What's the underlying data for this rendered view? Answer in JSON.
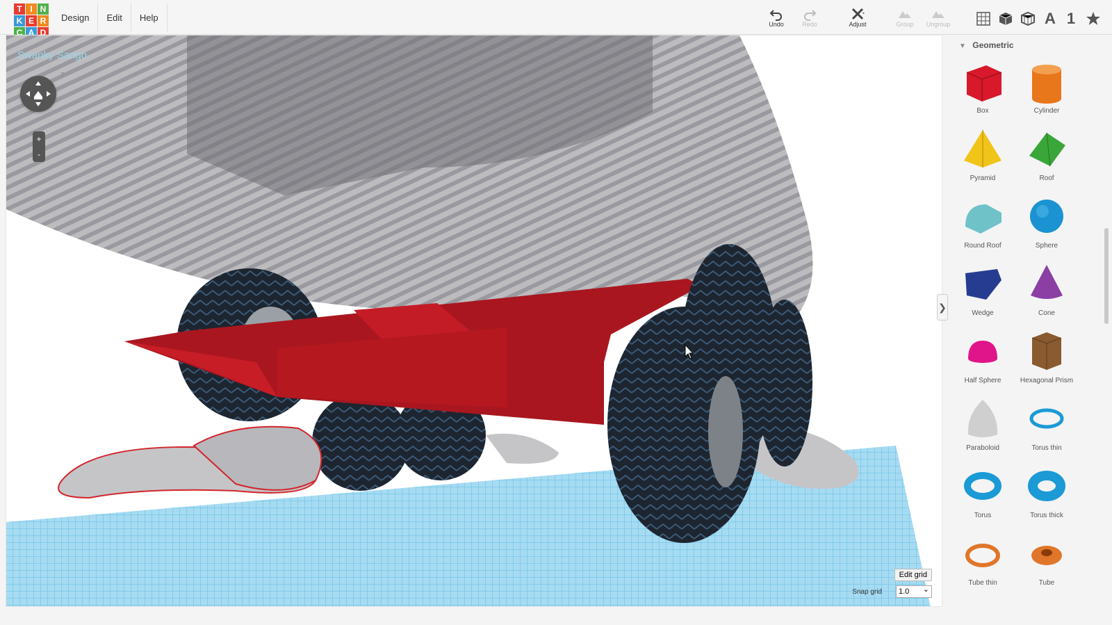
{
  "logo": {
    "letters": [
      "T",
      "I",
      "N",
      "K",
      "E",
      "R",
      "C",
      "A",
      "D"
    ],
    "colors": [
      "#e83c32",
      "#f08c1e",
      "#4fb04a",
      "#3a9ad9",
      "#e83c32",
      "#f08c1e",
      "#4fb04a",
      "#3a9ad9",
      "#e83c32"
    ]
  },
  "menu": [
    "Design",
    "Edit",
    "Help"
  ],
  "toolbar": {
    "undo": "Undo",
    "redo": "Redo",
    "adjust": "Adjust",
    "group": "Group",
    "ungroup": "Ungroup"
  },
  "view_icons": {
    "grid": "grid-icon",
    "box": "box-view-icon",
    "wire": "wireframe-icon",
    "text": "A",
    "number": "1",
    "star": "star-icon"
  },
  "project": {
    "title": "Swanky Sango"
  },
  "navigation": {
    "zoom_in": "+",
    "zoom_out": "-",
    "help": "?"
  },
  "grid": {
    "edit_label": "Edit grid",
    "snap_label": "Snap grid",
    "snap_value": "1.0"
  },
  "panel": {
    "section": "Geometric",
    "shapes": [
      {
        "name": "Box",
        "icon": "box-shape-icon",
        "color": "#d7192b"
      },
      {
        "name": "Cylinder",
        "icon": "cylinder-shape-icon",
        "color": "#e8761a"
      },
      {
        "name": "Pyramid",
        "icon": "pyramid-shape-icon",
        "color": "#f0c419"
      },
      {
        "name": "Roof",
        "icon": "roof-shape-icon",
        "color": "#3aa63a"
      },
      {
        "name": "Round Roof",
        "icon": "round-roof-shape-icon",
        "color": "#6fc2c8"
      },
      {
        "name": "Sphere",
        "icon": "sphere-shape-icon",
        "color": "#1b93d2"
      },
      {
        "name": "Wedge",
        "icon": "wedge-shape-icon",
        "color": "#263c91"
      },
      {
        "name": "Cone",
        "icon": "cone-shape-icon",
        "color": "#8b3fa5"
      },
      {
        "name": "Half Sphere",
        "icon": "half-sphere-shape-icon",
        "color": "#e0158a"
      },
      {
        "name": "Hexagonal Prism",
        "icon": "hexagonal-prism-shape-icon",
        "color": "#8a5a30"
      },
      {
        "name": "Paraboloid",
        "icon": "paraboloid-shape-icon",
        "color": "#cfcfcf"
      },
      {
        "name": "Torus thin",
        "icon": "torus-thin-shape-icon",
        "color": "#1b9ad6"
      },
      {
        "name": "Torus",
        "icon": "torus-shape-icon",
        "color": "#1b9ad6"
      },
      {
        "name": "Torus thick",
        "icon": "torus-thick-shape-icon",
        "color": "#1b9ad6"
      },
      {
        "name": "Tube thin",
        "icon": "tube-thin-shape-icon",
        "color": "#e0762a"
      },
      {
        "name": "Tube",
        "icon": "tube-shape-icon",
        "color": "#e0762a"
      }
    ]
  }
}
